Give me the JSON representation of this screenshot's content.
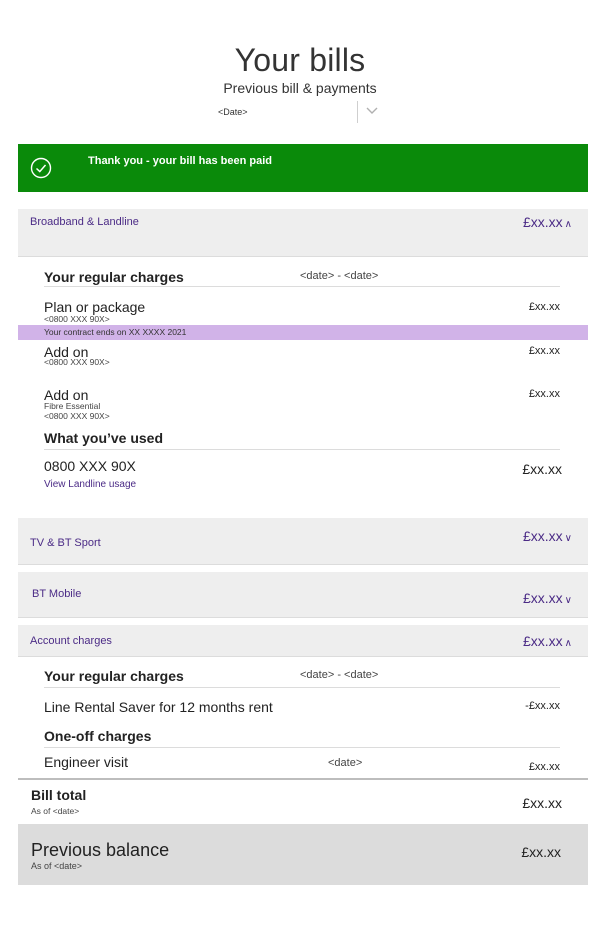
{
  "header": {
    "title": "Your bills",
    "subtitle": "Previous bill & payments",
    "date_select_value": "<Date>"
  },
  "banner": {
    "message": "Thank you - your bill has been paid",
    "color": "#0a8a0a"
  },
  "broadband": {
    "label": "Broadband & Landline",
    "amount": "£xx.xx",
    "regular_heading": "Your regular charges",
    "regular_dates": "<date> - <date>",
    "plan_label": "Plan or package",
    "plan_number": "<0800 XXX 90X>",
    "plan_amount": "£xx.xx",
    "contract_note": "Your contract ends on XX XXXX 2021",
    "addon1_label": "Add on",
    "addon1_number": "<0800 XXX 90X>",
    "addon1_amount": "£xx.xx",
    "addon2_label": "Add on",
    "addon2_detail": "Fibre Essential",
    "addon2_number": "<0800 XXX 90X>",
    "addon2_amount": "£xx.xx",
    "used_heading": "What you’ve used",
    "used_number": "0800 XXX 90X",
    "used_link": "View Landline usage",
    "used_amount": "£xx.xx"
  },
  "tv": {
    "label": "TV & BT Sport",
    "amount": "£xx.xx"
  },
  "mobile": {
    "label": "BT Mobile",
    "amount": "£xx.xx"
  },
  "account": {
    "label": "Account charges",
    "amount": "£xx.xx",
    "regular_heading": "Your regular charges",
    "regular_dates": "<date> - <date>",
    "line_rental_label": "Line Rental Saver for 12 months rent",
    "line_rental_amount": "-£xx.xx",
    "oneoff_heading": "One-off charges",
    "engineer_label": "Engineer visit",
    "engineer_date": "<date>",
    "engineer_amount": "£xx.xx"
  },
  "bill_total": {
    "label": "Bill total",
    "as_of": "As of <date>",
    "amount": "£xx.xx"
  },
  "previous_balance": {
    "label": "Previous balance",
    "as_of": "As of <date>",
    "amount": "£xx.xx"
  },
  "colors": {
    "accent": "#4b2b86",
    "success": "#0a8a0a",
    "highlight": "#d1b3e8",
    "section_bg": "#eeeeee"
  }
}
